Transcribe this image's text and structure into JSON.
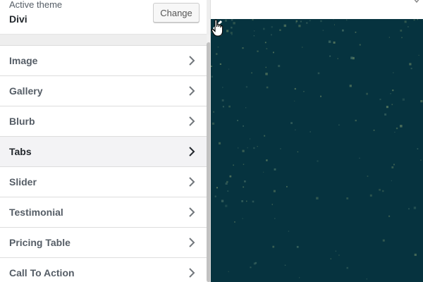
{
  "theme": {
    "label": "Active theme",
    "name": "Divi",
    "change_label": "Change"
  },
  "sections": [
    {
      "label": "Image"
    },
    {
      "label": "Gallery"
    },
    {
      "label": "Blurb"
    },
    {
      "label": "Tabs",
      "active": true
    },
    {
      "label": "Slider"
    },
    {
      "label": "Testimonial"
    },
    {
      "label": "Pricing Table"
    },
    {
      "label": "Call To Action"
    }
  ],
  "icons": {
    "section_chevron": "chevron-right-icon",
    "slider_prev": "arrow-left-icon",
    "cursor": "hand-pointer-icon",
    "topbar": "device-icon"
  },
  "colors": {
    "slider_background": "#06333f",
    "panel_background": "#eeeeee",
    "active_item": "#f3f3f5"
  }
}
